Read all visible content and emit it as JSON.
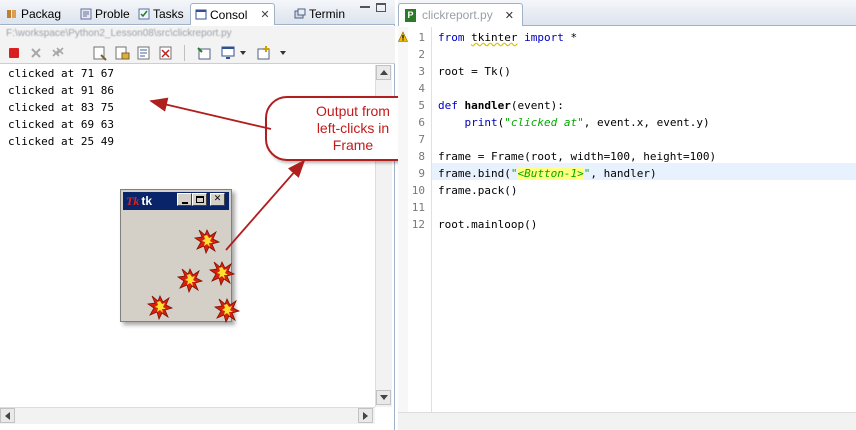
{
  "left_panel": {
    "tabs": [
      {
        "label": "Packag",
        "icon": "package-explorer-icon"
      },
      {
        "label": "Proble",
        "icon": "problems-icon"
      },
      {
        "label": "Tasks",
        "icon": "tasks-icon"
      },
      {
        "label": "Consol",
        "icon": "console-icon",
        "active": true
      },
      {
        "label": "Termin",
        "icon": "terminal-icon"
      }
    ],
    "console_path": "F:\\workspace\\Python2_Lesson08\\src\\clickreport.py",
    "console_lines": [
      "clicked at 71 67",
      "clicked at 91 86",
      "clicked at 83 75",
      "clicked at 69 63",
      "clicked at 25 49"
    ]
  },
  "tk_window": {
    "title": "tk",
    "icon": "tk-feather-icon"
  },
  "callout": {
    "text": "Output from\nleft-clicks in\nFrame"
  },
  "editor": {
    "tab_label": "clickreport.py",
    "line_numbers": [
      "1",
      "2",
      "3",
      "4",
      "5",
      "6",
      "7",
      "8",
      "9",
      "10",
      "11",
      "12"
    ],
    "lines": {
      "l1_kw1": "from",
      "l1_mod": "tkinter",
      "l1_kw2": "import",
      "l1_rest": " *",
      "l3": "root = Tk()",
      "l5_kw": "def",
      "l5_fn": "handler",
      "l5_rest": "(event):",
      "l6_kw": "print",
      "l6_open": "(",
      "l6_str": "\"clicked at\"",
      "l6_rest": ", event.x, event.y)",
      "l8": "frame = Frame(root, width=100, height=100)",
      "l9_pre": "frame.bind(",
      "l9_q1": "\"",
      "l9_strhl": "<Button-1>",
      "l9_q2": "\"",
      "l9_rest": ", handler)",
      "l10": "frame.pack()",
      "l12": "root.mainloop()"
    }
  },
  "colors": {
    "keyword": "#0000c0",
    "string": "#00aa00",
    "callout_border": "#b01e1e",
    "callout_text": "#c41a1a",
    "title_bar": "#0a246a"
  }
}
